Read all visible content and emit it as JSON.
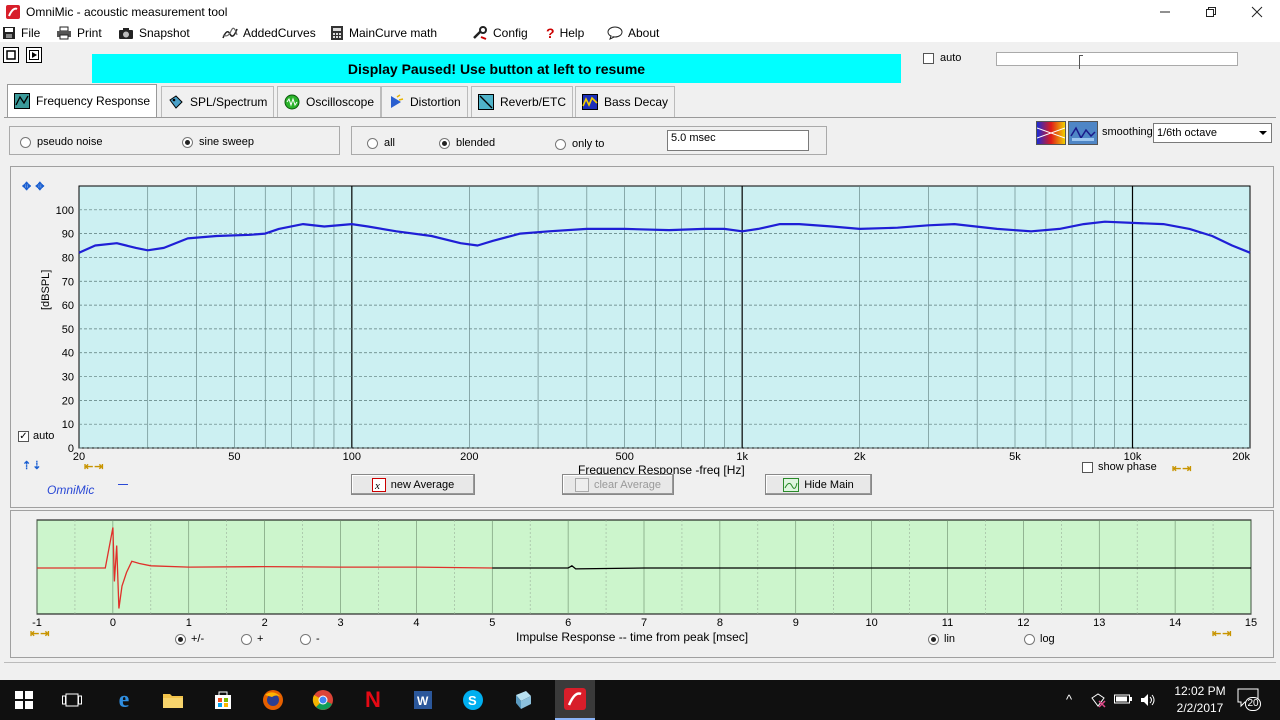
{
  "window": {
    "title": "OmniMic - acoustic measurement tool"
  },
  "menu": [
    {
      "label": "File",
      "icon": "save-icon"
    },
    {
      "label": "Print",
      "icon": "printer-icon"
    },
    {
      "label": "Snapshot",
      "icon": "camera-icon"
    },
    {
      "label": "AddedCurves",
      "icon": "curves-icon"
    },
    {
      "label": "MainCurve math",
      "icon": "calculator-icon"
    },
    {
      "label": "Config",
      "icon": "wrench-icon"
    },
    {
      "label": "Help",
      "icon": "question-icon"
    },
    {
      "label": "About",
      "icon": "speech-bubble-icon"
    }
  ],
  "toolbar": {
    "banner": "Display Paused! Use button at left to resume",
    "auto_label": "auto",
    "auto_checked": false
  },
  "tabs": [
    {
      "label": "Frequency Response",
      "active": true
    },
    {
      "label": "SPL/Spectrum",
      "active": false
    },
    {
      "label": "Oscilloscope",
      "active": false
    },
    {
      "label": "Distortion",
      "active": false
    },
    {
      "label": "Reverb/ETC",
      "active": false
    },
    {
      "label": "Bass Decay",
      "active": false
    }
  ],
  "signal": {
    "options": [
      "pseudo noise",
      "sine sweep"
    ],
    "selected": "sine sweep"
  },
  "window_mode": {
    "options": [
      "all",
      "blended",
      "only to"
    ],
    "selected": "blended",
    "gate_value": "5.0 msec"
  },
  "smoothing": {
    "label": "smoothing",
    "value": "1/6th octave"
  },
  "freq_chart": {
    "y_axis_label": "[dBSPL]",
    "x_axis_label": "Frequency Response -freq [Hz]",
    "y_ticks": [
      100,
      90,
      80,
      70,
      60,
      50,
      40,
      30,
      20,
      10,
      0
    ],
    "x_ticks": [
      "20",
      "50",
      "100",
      "200",
      "500",
      "1k",
      "2k",
      "5k",
      "10k",
      "20k"
    ],
    "auto_label": "auto",
    "auto_checked": true,
    "show_phase_label": "show phase",
    "brand": "OmniMic",
    "buttons": {
      "new_average": "new Average",
      "clear_average": "clear Average",
      "hide_main": "Hide Main"
    }
  },
  "impulse_chart": {
    "x_axis_label": "Impulse Response  -- time from peak [msec]",
    "x_ticks": [
      "-1",
      "0",
      "1",
      "2",
      "3",
      "4",
      "5",
      "6",
      "7",
      "8",
      "9",
      "10",
      "11",
      "12",
      "13",
      "14",
      "15"
    ],
    "polarity_options": [
      "+/-",
      "+",
      "-"
    ],
    "polarity_selected": "+/-",
    "scale_options": [
      "lin",
      "log"
    ],
    "scale_selected": "lin"
  },
  "chart_data": [
    {
      "type": "line",
      "title": "",
      "xlabel": "Frequency Response -freq [Hz]",
      "ylabel": "[dBSPL]",
      "x_scale": "log",
      "xlim": [
        20,
        20000
      ],
      "ylim": [
        0,
        110
      ],
      "grid": true,
      "series": [
        {
          "color": "#1f1fd6",
          "x": [
            20,
            22,
            25,
            28,
            30,
            33,
            38,
            45,
            55,
            60,
            65,
            75,
            85,
            100,
            110,
            130,
            160,
            190,
            210,
            230,
            270,
            320,
            400,
            500,
            650,
            800,
            900,
            1000,
            1100,
            1250,
            1400,
            1700,
            2000,
            2500,
            3000,
            3500,
            4500,
            5500,
            6500,
            7500,
            8500,
            10000,
            12000,
            14000,
            16000,
            18000,
            20000
          ],
          "y": [
            82,
            85,
            86,
            84,
            83,
            84,
            88,
            89,
            89.5,
            90,
            92,
            94,
            93,
            94,
            93,
            91,
            89,
            86,
            85,
            87,
            90,
            91,
            92,
            92,
            91.5,
            92,
            92,
            91,
            92,
            94,
            94,
            93,
            92,
            92.5,
            93.5,
            94,
            92,
            91,
            92,
            94,
            95,
            94.5,
            94,
            92,
            89,
            85,
            82
          ]
        }
      ]
    },
    {
      "type": "line",
      "title": "",
      "xlabel": "Impulse Response  -- time from peak [msec]",
      "ylabel": "",
      "xlim": [
        -1,
        15
      ],
      "grid": true,
      "series": [
        {
          "color": "#e0302a",
          "x": [
            -1,
            -0.1,
            0,
            0.02,
            0.05,
            0.08,
            0.12,
            0.18,
            0.25,
            0.35,
            0.5,
            1,
            2,
            3,
            4,
            5
          ],
          "y": [
            0,
            0,
            0.9,
            -0.3,
            0.5,
            -0.9,
            -0.4,
            -0.1,
            0.15,
            0.1,
            0.05,
            0.02,
            0.03,
            0.02,
            0.02,
            0
          ]
        },
        {
          "color": "#000000",
          "x": [
            5,
            6,
            6.05,
            6.1,
            7,
            8,
            9,
            10,
            11,
            12,
            13,
            14,
            15
          ],
          "y": [
            0,
            0,
            0.05,
            -0.02,
            0,
            0,
            0,
            0,
            0,
            0,
            0,
            0,
            0
          ]
        }
      ]
    }
  ],
  "taskbar": {
    "time": "12:02 PM",
    "date": "2/2/2017",
    "notifications": "20"
  }
}
